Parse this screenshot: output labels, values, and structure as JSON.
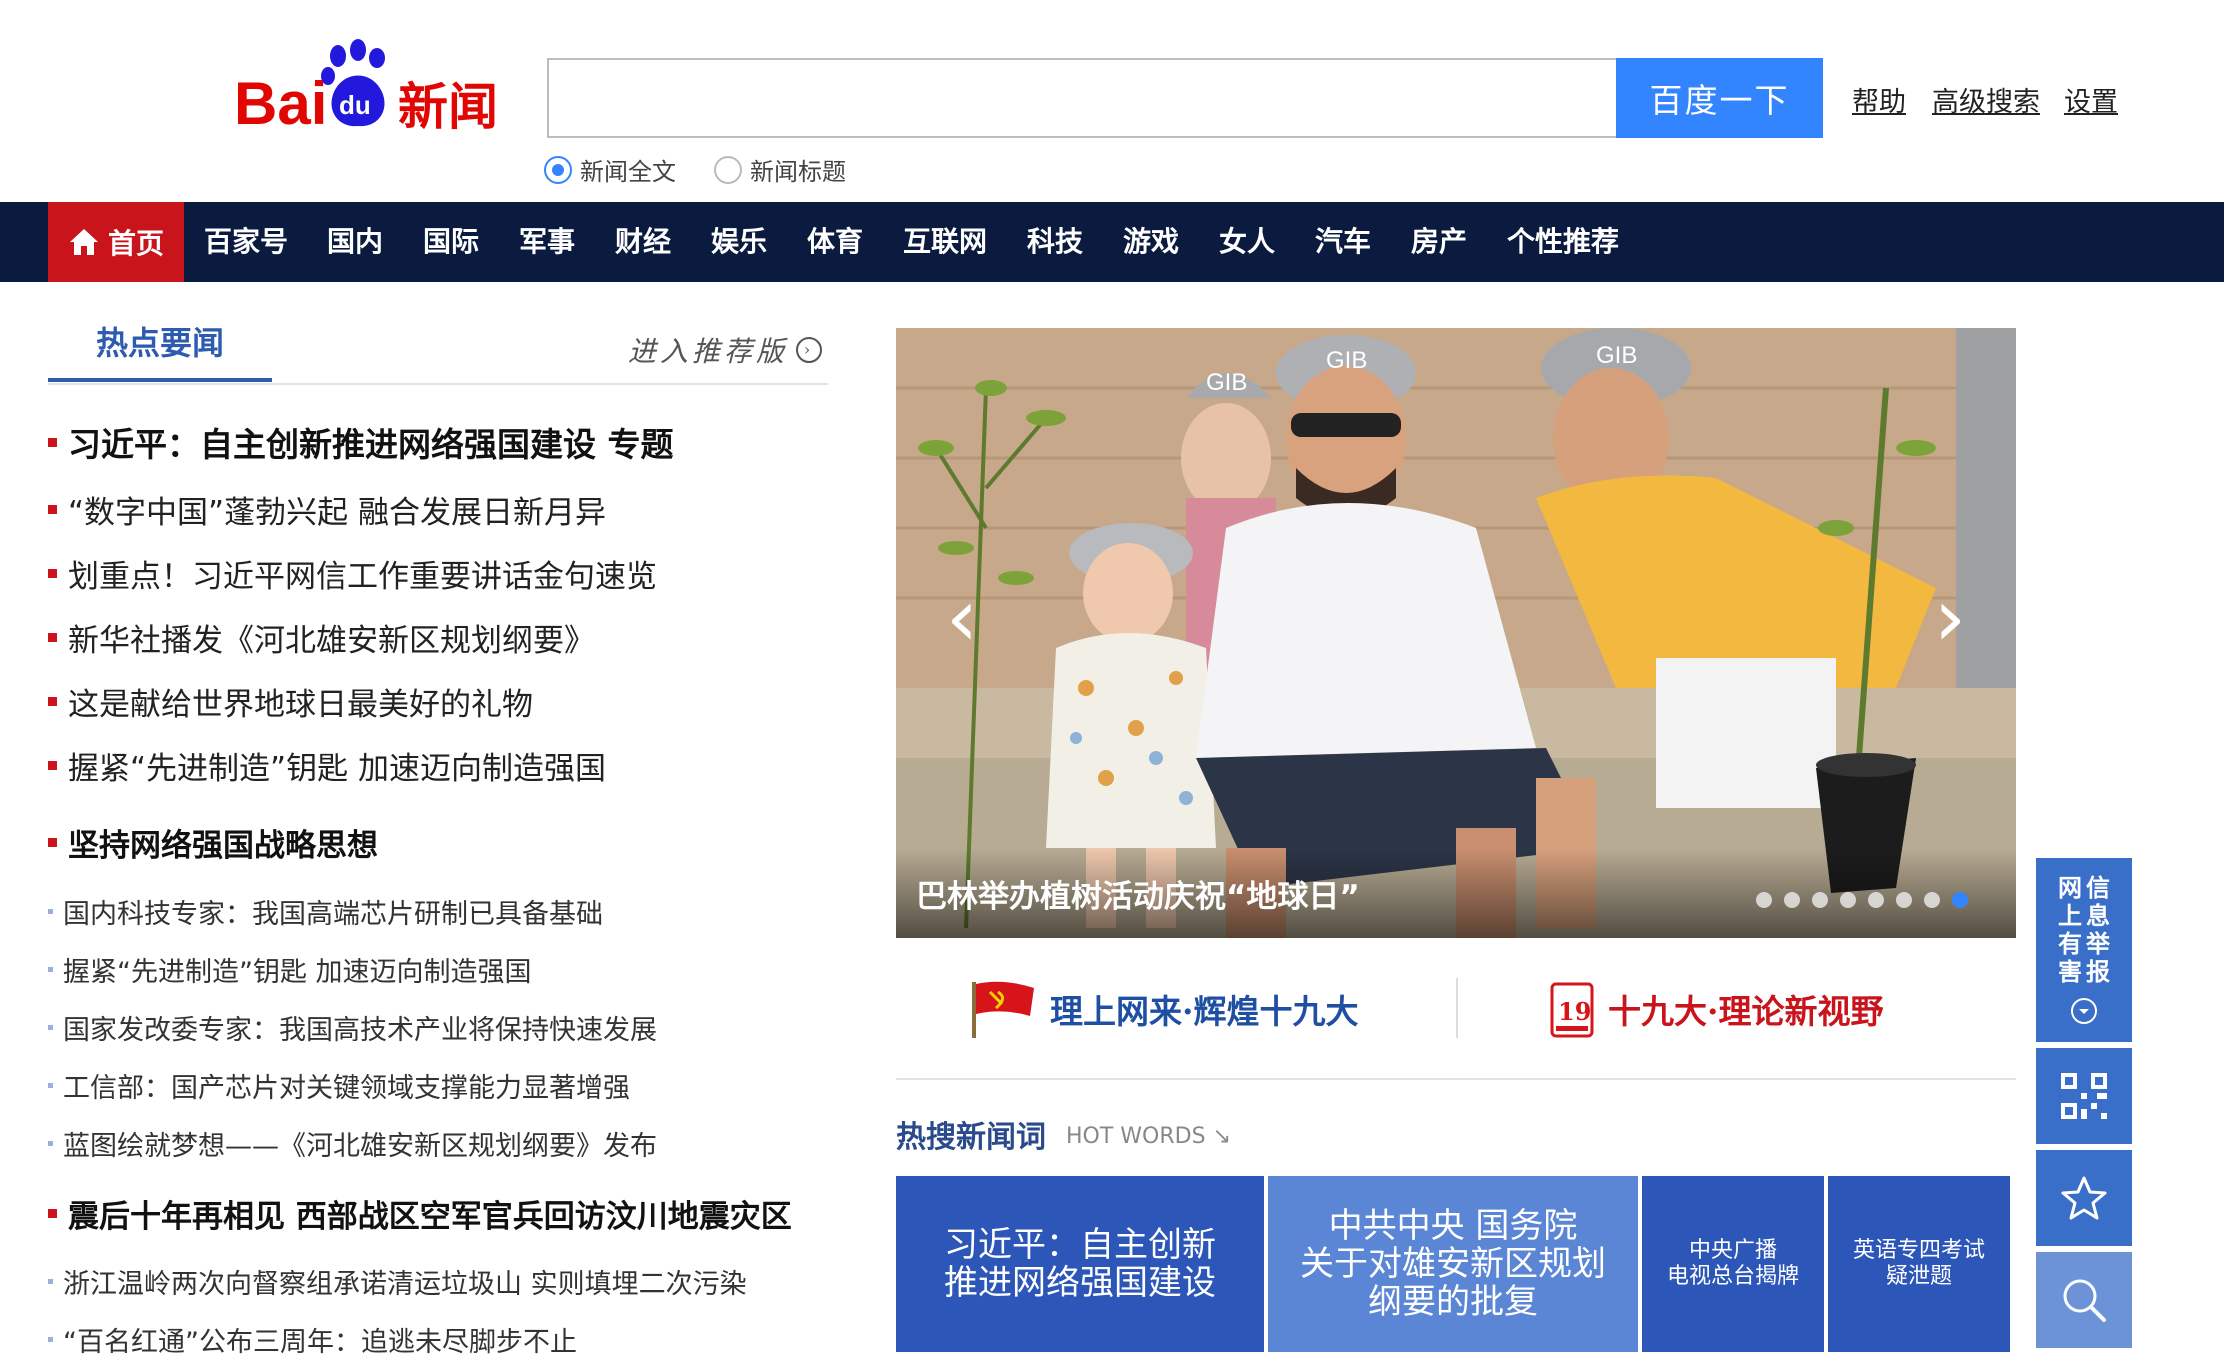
{
  "header": {
    "logo_text": "Baidu新闻",
    "search_button": "百度一下",
    "links": [
      "帮助",
      "高级搜索",
      "设置"
    ],
    "search_value": "",
    "radio_options": [
      {
        "label": "新闻全文",
        "checked": true
      },
      {
        "label": "新闻标题",
        "checked": false
      }
    ]
  },
  "nav": {
    "home": "首页",
    "items": [
      "百家号",
      "国内",
      "国际",
      "军事",
      "财经",
      "娱乐",
      "体育",
      "互联网",
      "科技",
      "游戏",
      "女人",
      "汽车",
      "房产",
      "个性推荐"
    ]
  },
  "hot_news": {
    "tab": "热点要闻",
    "enter_recommend": "进入推荐版",
    "headlines": [
      "习近平：自主创新推进网络强国建设 专题",
      "“数字中国”蓬勃兴起 融合发展日新月异",
      "划重点！习近平网信工作重要讲话金句速览",
      "新华社播发《河北雄安新区规划纲要》",
      "这是献给世界地球日最美好的礼物",
      "握紧“先进制造”钥匙 加速迈向制造强国"
    ],
    "section2_title": "坚持网络强国战略思想",
    "section2_items": [
      "国内科技专家：我国高端芯片研制已具备基础",
      "握紧“先进制造”钥匙 加速迈向制造强国",
      "国家发改委专家：我国高技术产业将保持快速发展",
      "工信部：国产芯片对关键领域支撑能力显著增强",
      "蓝图绘就梦想——《河北雄安新区规划纲要》发布"
    ],
    "section3_title": "震后十年再相见 西部战区空军官兵回访汶川地震灾区",
    "section3_items": [
      "浙江温岭两次向督察组承诺清运垃圾山 实则填埋二次污染",
      "“百名红通”公布三周年：追逃未尽脚步不止"
    ]
  },
  "carousel": {
    "caption": "巴林举办植树活动庆祝“地球日”",
    "slide_count": 8,
    "active_index": 7,
    "prev_icon": "‹",
    "next_icon": "›",
    "cap_text": "GIB"
  },
  "banners": {
    "left": "理上网来·辉煌十九大",
    "right": "十九大·理论新视野",
    "left_color": "#1f4fa3",
    "right_color": "#c9141c"
  },
  "hot_words": {
    "title": "热搜新闻词",
    "subtitle": "HOT WORDS",
    "words": [
      {
        "text": "习近平：自主创新\n推进网络强国建设",
        "color": "#2c56b8"
      },
      {
        "text": "中共中央 国务院\n关于对雄安新区规划\n纲要的批复",
        "color": "#5b86d6"
      },
      {
        "text": "中央广播\n电视总台揭牌",
        "color": "#2c56b8"
      },
      {
        "text": "英语专四考试\n疑泄题",
        "color": "#2c56b8"
      }
    ]
  },
  "side_tools": {
    "report_label": "网信上息有举害报",
    "report_col1": "网上有害",
    "report_col2": "信息举报"
  },
  "colors": {
    "nav_bg": "#0b1b3f",
    "home_red": "#c9141c",
    "accent_blue": "#3385ff",
    "tool_blue": "#3a6fc9"
  }
}
